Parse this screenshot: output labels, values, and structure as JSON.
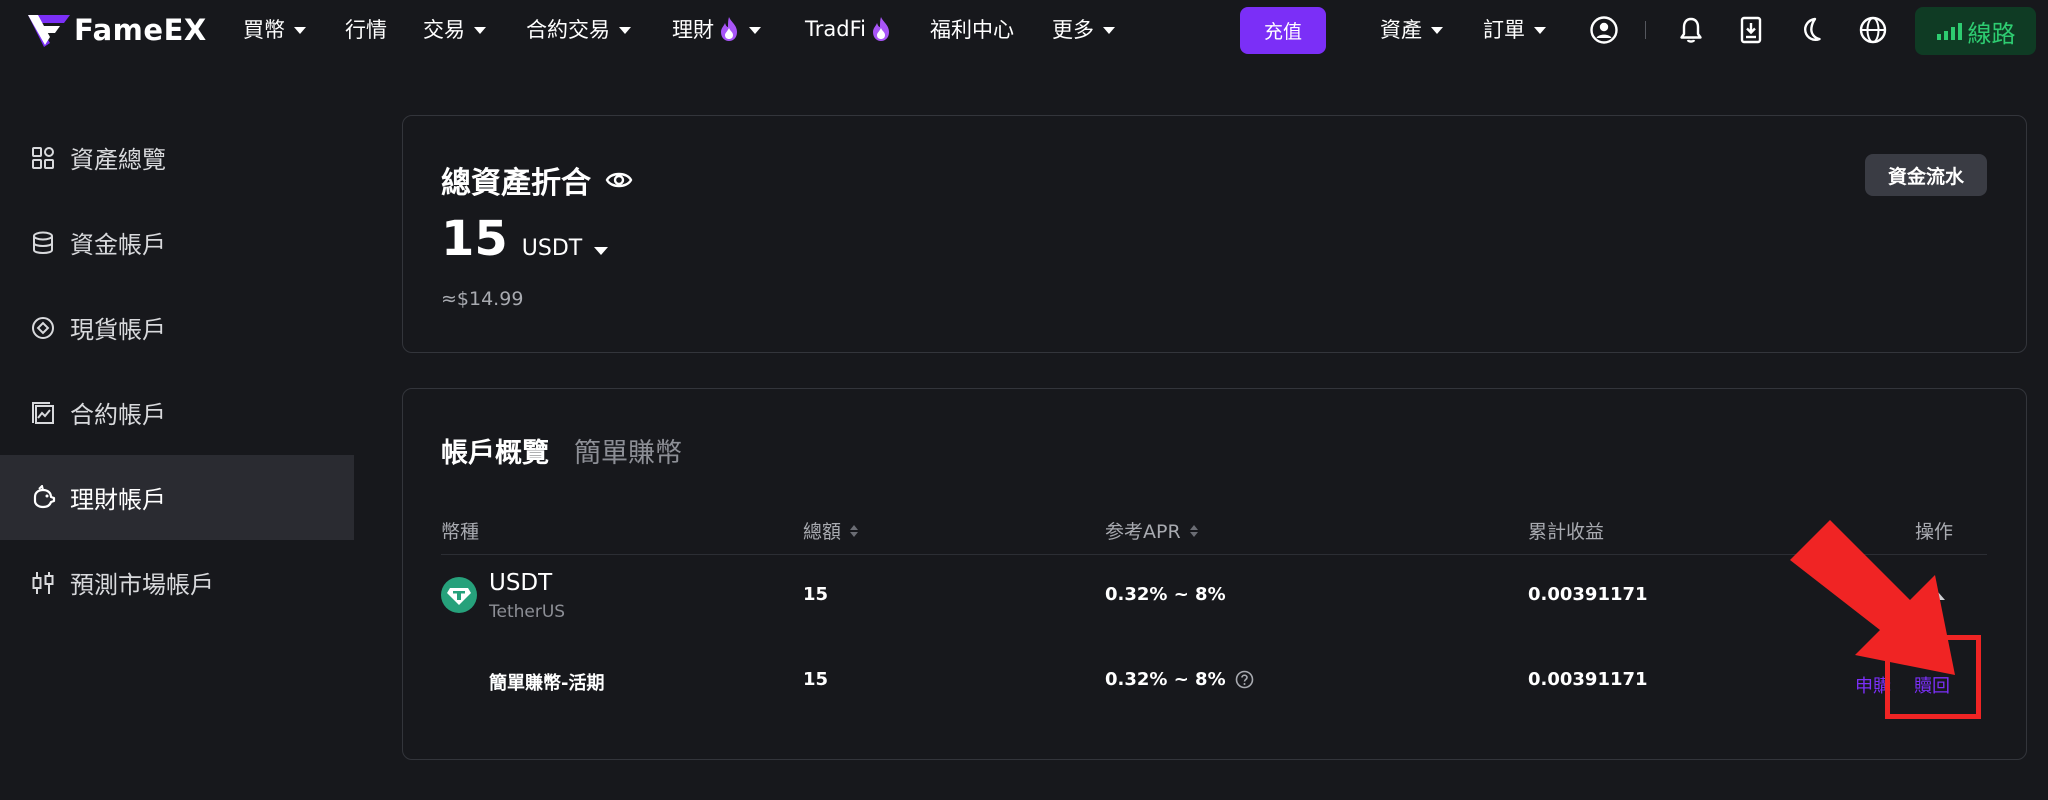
{
  "nav": {
    "logo_text": "FameEX",
    "items": [
      {
        "label": "買幣"
      },
      {
        "label": "行情"
      },
      {
        "label": "交易"
      },
      {
        "label": "合約交易"
      },
      {
        "label": "理財"
      },
      {
        "label": "TradFi"
      },
      {
        "label": "福利中心"
      },
      {
        "label": "更多"
      }
    ],
    "deposit_label": "充值",
    "assets_label": "資產",
    "orders_label": "訂單",
    "line_label": "線路",
    "icons": [
      "user-icon",
      "bell-icon",
      "download-icon",
      "moon-icon",
      "globe-icon"
    ]
  },
  "sidebar": {
    "items": [
      {
        "label": "資產總覽",
        "icon": "grid-icon"
      },
      {
        "label": "資金帳戶",
        "icon": "database-icon"
      },
      {
        "label": "現貨帳戶",
        "icon": "target-icon"
      },
      {
        "label": "合約帳戶",
        "icon": "chart-icon"
      },
      {
        "label": "理財帳戶",
        "icon": "piggy-bank-icon"
      },
      {
        "label": "預測市場帳戶",
        "icon": "candlestick-icon"
      }
    ],
    "active_index": 4
  },
  "summary": {
    "title": "總資產折合",
    "flow_label": "資金流水",
    "balance": "15",
    "unit": "USDT",
    "approx": "≈$14.99"
  },
  "overview": {
    "tabs": [
      {
        "label": "帳戶概覽"
      },
      {
        "label": "簡單賺幣"
      }
    ],
    "columns": {
      "coin": "幣種",
      "total": "總額",
      "apr": "参考APR",
      "earnings": "累計收益",
      "action": "操作"
    },
    "row": {
      "coin": "USDT",
      "coin_sub": "TetherUS",
      "total": "15",
      "apr": "0.32% ~ 8%",
      "earnings": "0.00391171"
    },
    "subrow": {
      "product": "簡單賺幣-活期",
      "total": "15",
      "apr": "0.32% ~ 8%",
      "earnings": "0.00391171",
      "subscribe_label": "申購",
      "redeem_label": "贖回"
    }
  },
  "colors": {
    "accent": "#7b2ff7",
    "background": "#17181c",
    "line_green": "#2ecc71",
    "annotation_red": "#f02424",
    "usdt_teal": "#26a17b"
  }
}
